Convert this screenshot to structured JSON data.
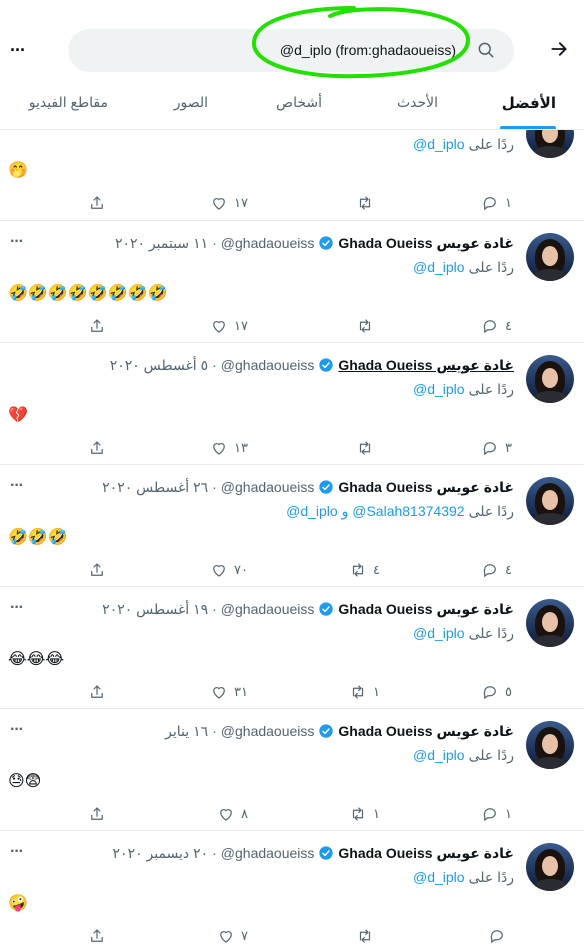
{
  "search": {
    "query": "@d_iplo (from:ghadaoueiss)",
    "more_label": "···"
  },
  "tabs": [
    {
      "label": "الأفضل",
      "active": true
    },
    {
      "label": "الأحدث",
      "active": false
    },
    {
      "label": "أشخاص",
      "active": false
    },
    {
      "label": "الصور",
      "active": false
    },
    {
      "label": "مقاطع الفيديو",
      "active": false
    }
  ],
  "colors": {
    "accent": "#1d9bf0",
    "highlight": "#22e000"
  },
  "tweets": [
    {
      "name": "",
      "handle": "",
      "date": "",
      "reply_prefix": "ردًا على",
      "mentions": "@d_iplo",
      "emoji": "🤭",
      "replies": "١",
      "retweets": "",
      "likes": "١٧"
    },
    {
      "name": "غادة عويس Ghada Oueiss",
      "handle": "@ghadaoueiss",
      "date": "١١ سبتمبر ٢٠٢٠",
      "reply_prefix": "ردًا على",
      "mentions": "@d_iplo",
      "emoji": "🤣🤣🤣🤣🤣🤣🤣🤣",
      "replies": "٤",
      "retweets": "",
      "likes": "١٧"
    },
    {
      "name": "غادة عويس Ghada Oueiss",
      "handle": "@ghadaoueiss",
      "date": "٥ أغسطس ٢٠٢٠",
      "reply_prefix": "ردًا على",
      "mentions": "@d_iplo",
      "emoji": "💔",
      "replies": "٣",
      "retweets": "",
      "likes": "١٣"
    },
    {
      "name": "غادة عويس Ghada Oueiss",
      "handle": "@ghadaoueiss",
      "date": "٢٦ أغسطس ٢٠٢٠",
      "reply_prefix": "ردًا على",
      "mentions": "@d_iplo و @Salah81374392",
      "emoji": "🤣🤣🤣",
      "replies": "٤",
      "retweets": "٤",
      "likes": "٧٠"
    },
    {
      "name": "غادة عويس Ghada Oueiss",
      "handle": "@ghadaoueiss",
      "date": "١٩ أغسطس ٢٠٢٠",
      "reply_prefix": "ردًا على",
      "mentions": "@d_iplo",
      "emoji": "😂😂😂",
      "replies": "٥",
      "retweets": "١",
      "likes": "٣١"
    },
    {
      "name": "غادة عويس Ghada Oueiss",
      "handle": "@ghadaoueiss",
      "date": "١٦ يناير",
      "reply_prefix": "ردًا على",
      "mentions": "@d_iplo",
      "emoji": "😓😨",
      "replies": "١",
      "retweets": "١",
      "likes": "٨"
    },
    {
      "name": "غادة عويس Ghada Oueiss",
      "handle": "@ghadaoueiss",
      "date": "٢٠ ديسمبر ٢٠٢٠",
      "reply_prefix": "ردًا على",
      "mentions": "@d_iplo",
      "emoji": "🤪",
      "replies": "",
      "retweets": "",
      "likes": "٧"
    }
  ]
}
